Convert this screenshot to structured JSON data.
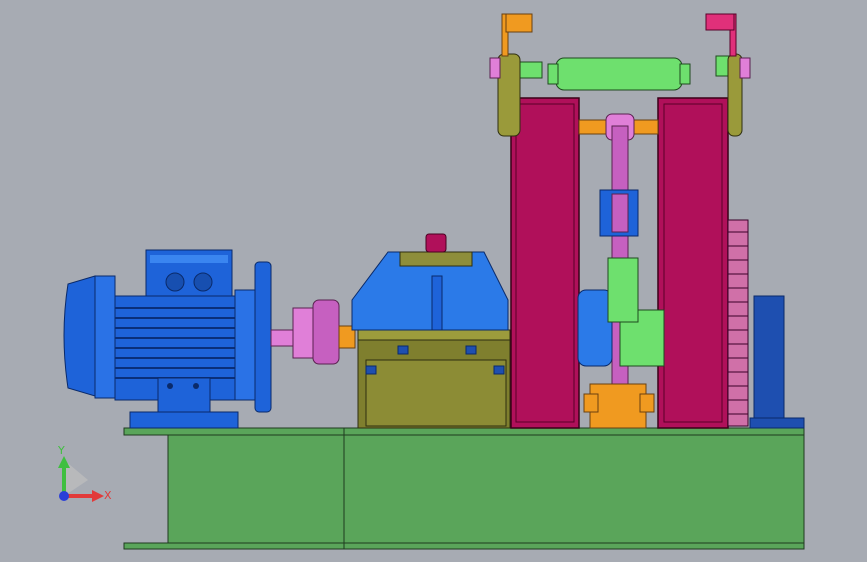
{
  "viewport": {
    "background": "#a7abb3"
  },
  "triad": {
    "y_label": "Y",
    "x_label": "X",
    "y_color": "#3fbf3f",
    "x_color": "#e23a3a",
    "origin_color": "#2a3fd8"
  },
  "colors": {
    "base_frame": "#5aa55a",
    "motor": "#1e63d9",
    "gearbox_top": "#2b7ae8",
    "gearbox_housing": "#7f7f2e",
    "coupling": "#e07fd8",
    "roller_frame": "#b0105a",
    "roller_green": "#6ee06e",
    "gear": "#c03a8a",
    "bracket_orange": "#f09a20",
    "lever_olive": "#9a9a3a"
  }
}
